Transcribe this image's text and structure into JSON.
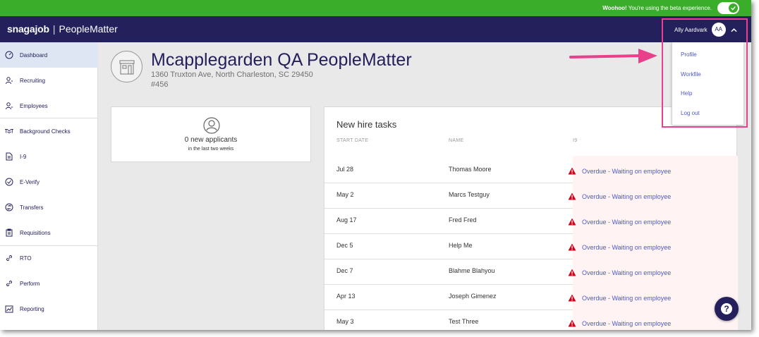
{
  "beta_bar": {
    "strong": "Woohoo!",
    "text": " You're using the beta experience."
  },
  "header": {
    "brand_main": "snagajob",
    "brand_separator": "|",
    "brand_sub": "PeopleMatter",
    "user_name": "Ally Aardvark",
    "user_initials": "AA"
  },
  "sidebar": {
    "items": [
      {
        "label": "Dashboard",
        "icon": "dashboard-gauge-icon",
        "active": true
      },
      {
        "label": "Recruiting",
        "icon": "recruiting-person-icon"
      },
      {
        "label": "Employees",
        "icon": "employees-person-icon"
      },
      {
        "label": "Background Checks",
        "icon": "handshake-icon"
      },
      {
        "label": "I-9",
        "icon": "document-icon"
      },
      {
        "label": "E-Verify",
        "icon": "check-circle-icon"
      },
      {
        "label": "Transfers",
        "icon": "transfer-icon"
      },
      {
        "label": "Requisitions",
        "icon": "clipboard-icon"
      },
      {
        "label": "RTO",
        "icon": "link-icon"
      },
      {
        "label": "Perform",
        "icon": "link-icon"
      },
      {
        "label": "Reporting",
        "icon": "chart-icon"
      }
    ]
  },
  "location": {
    "title": "Mcapplegarden QA PeopleMatter",
    "address": "1360 Truxton Ave, North Charleston, SC 29450",
    "number": "#456"
  },
  "applicants": {
    "count_label": "0 new applicants",
    "sub_label": "in the last two weeks"
  },
  "tasks": {
    "title": "New hire tasks",
    "columns": {
      "start": "START DATE",
      "name": "NAME",
      "i9": "I9"
    },
    "rows": [
      {
        "date": "Jul 28",
        "name": "Thomas Moore",
        "status": "Overdue - Waiting on employee"
      },
      {
        "date": "May 2",
        "name": "Marcs Testguy",
        "status": "Overdue - Waiting on employee"
      },
      {
        "date": "Aug 17",
        "name": "Fred Fred",
        "status": "Overdue - Waiting on employee"
      },
      {
        "date": "Dec 5",
        "name": "Help Me",
        "status": "Overdue - Waiting on employee"
      },
      {
        "date": "Dec 7",
        "name": "Blahme Blahyou",
        "status": "Overdue - Waiting on employee"
      },
      {
        "date": "Apr 13",
        "name": "Joseph Gimenez",
        "status": "Overdue - Waiting on employee"
      },
      {
        "date": "May 3",
        "name": "Test Three",
        "status": "Overdue - Waiting on employee"
      }
    ]
  },
  "dropdown": {
    "items": [
      "Profile",
      "Workfile",
      "Help",
      "Log out"
    ]
  },
  "help_button": {
    "label": "?"
  },
  "colors": {
    "brand": "#23205b",
    "beta_green": "#3aae2a",
    "link": "#4f59c7",
    "highlight": "#e8408a",
    "warning": "#d0021b"
  }
}
